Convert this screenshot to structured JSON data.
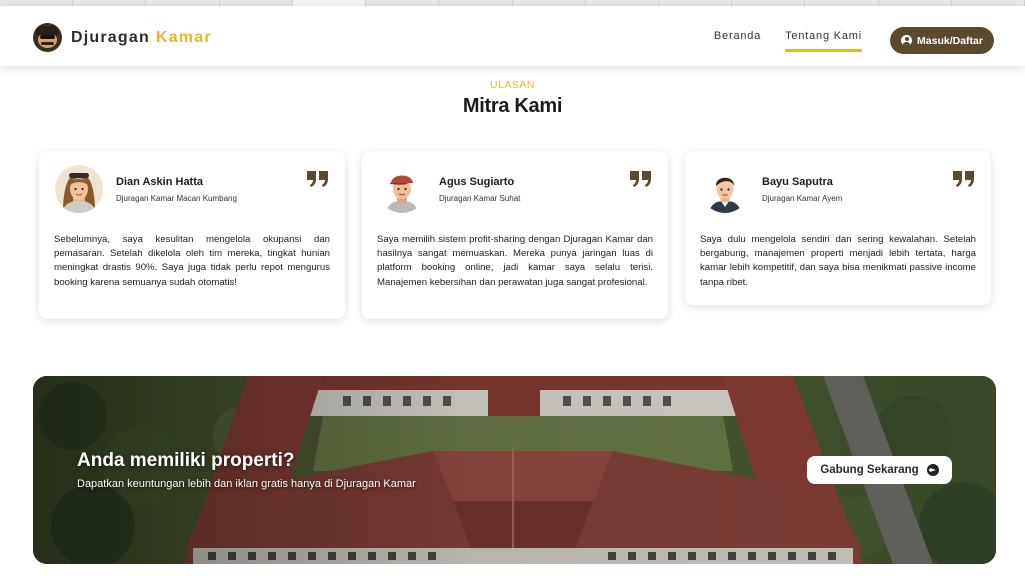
{
  "brand": {
    "name_part1": "Djuragan",
    "name_part2": "Kamar",
    "logo_icon": "mustache-man-logo-icon"
  },
  "nav": {
    "items": [
      {
        "label": "Beranda",
        "active": false
      },
      {
        "label": "Tentang Kami",
        "active": true
      }
    ],
    "login_label": "Masuk/Daftar"
  },
  "testimonials": {
    "kicker": "ULASAN",
    "title": "Mitra Kami",
    "items": [
      {
        "name": "Dian Askin Hatta",
        "role": "Djuragan Kamar Macan Kumbang",
        "text": "Sebelumnya, saya kesulitan mengelola okupansi dan pemasaran. Setelah dikelola oleh tim mereka, tingkat hunian meningkat drastis 90%. Saya juga tidak perlu repot mengurus booking karena semuanya sudah otomatis!"
      },
      {
        "name": "Agus Sugiarto",
        "role": "Djuragan Kamar Suhat",
        "text": "Saya memilih sistem profit-sharing dengan Djuragan Kamar dan hasilnya sangat memuaskan. Mereka punya jaringan luas di platform booking online, jadi kamar saya selalu terisi. Manajemen kebersihan dan perawatan juga sangat profesional."
      },
      {
        "name": "Bayu Saputra",
        "role": "Djuragan Kamar Ayem",
        "text": "Saya dulu mengelola sendiri dan sering kewalahan. Setelah bergabung, manajemen properti menjadi lebih tertata, harga kamar lebih kompetitif, dan saya bisa menikmati passive income tanpa ribet."
      }
    ]
  },
  "cta": {
    "title": "Anda memiliki properti?",
    "subtitle": "Dapatkan keuntungan lebih dan iklan gratis hanya di Djuragan Kamar",
    "button_label": "Gabung Sekarang"
  },
  "colors": {
    "accent": "#eab72a",
    "brown": "#5c4a30"
  }
}
